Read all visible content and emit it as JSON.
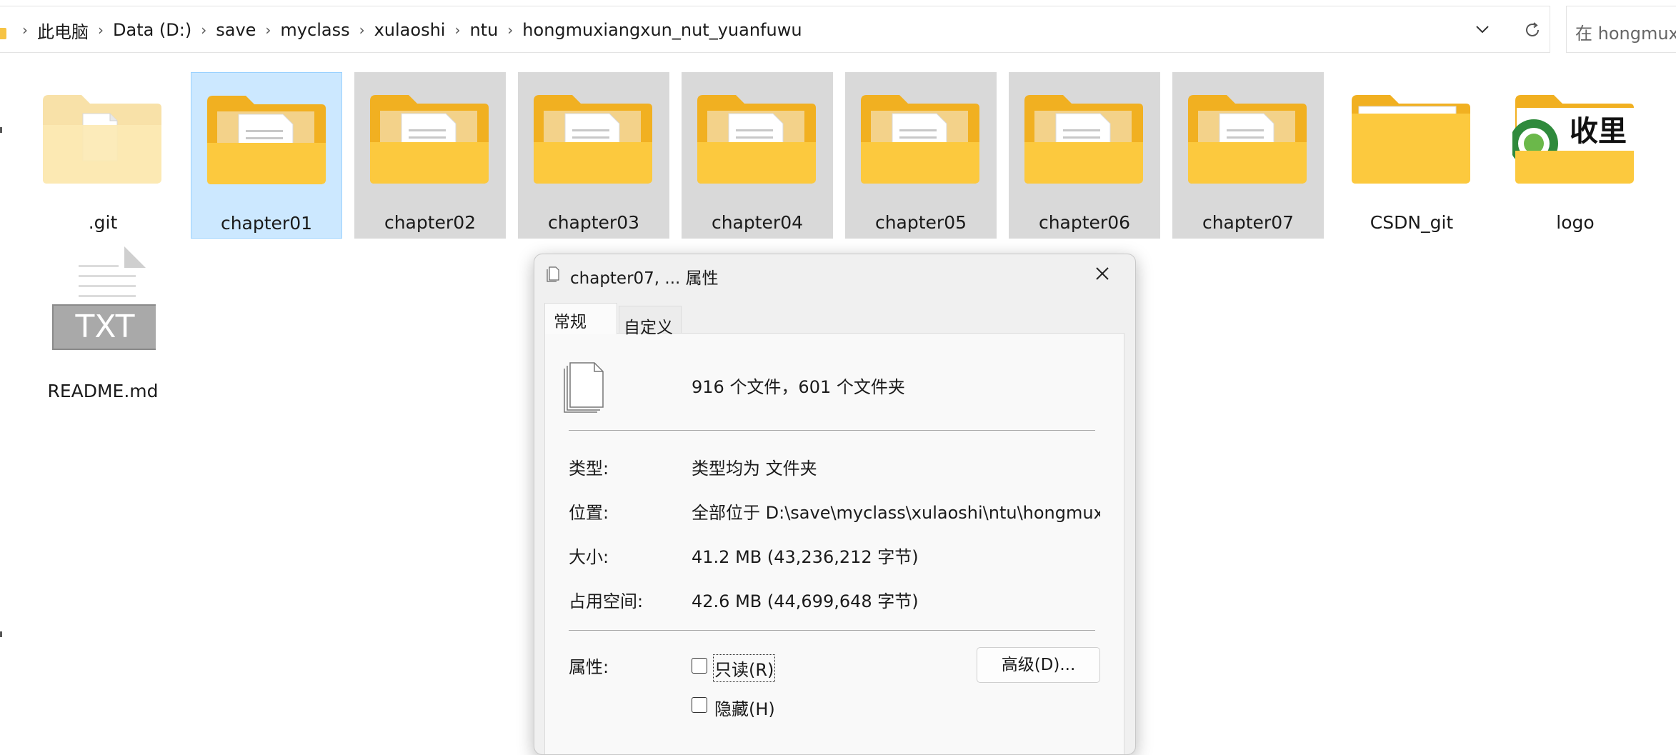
{
  "addressbar": {
    "breadcrumbs": [
      "此电脑",
      "Data (D:)",
      "save",
      "myclass",
      "xulaoshi",
      "ntu",
      "hongmuxiangxun_nut_yuanfuwu"
    ],
    "search_placeholder": "在 hongmux"
  },
  "files": [
    {
      "name": ".git",
      "kind": "folder-faded",
      "state": "normal"
    },
    {
      "name": "chapter01",
      "kind": "folder-docs",
      "state": "selected"
    },
    {
      "name": "chapter02",
      "kind": "folder-docs",
      "state": "highlighted"
    },
    {
      "name": "chapter03",
      "kind": "folder-docs",
      "state": "highlighted"
    },
    {
      "name": "chapter04",
      "kind": "folder-docs",
      "state": "highlighted"
    },
    {
      "name": "chapter05",
      "kind": "folder-docs",
      "state": "highlighted"
    },
    {
      "name": "chapter06",
      "kind": "folder-docs",
      "state": "highlighted"
    },
    {
      "name": "chapter07",
      "kind": "folder-docs",
      "state": "highlighted"
    },
    {
      "name": "CSDN_git",
      "kind": "folder-plain",
      "state": "normal"
    },
    {
      "name": "logo",
      "kind": "folder-logo",
      "state": "normal"
    },
    {
      "name": "README.md",
      "kind": "txt-file",
      "state": "normal"
    }
  ],
  "logo_thumbnail_text": "收里",
  "txt_icon_text": "TXT",
  "dialog": {
    "title": "chapter07, ... 属性",
    "tabs": [
      "常规",
      "自定义"
    ],
    "summary": "916 个文件，601 个文件夹",
    "rows": [
      {
        "label": "类型:",
        "value": "类型均为 文件夹"
      },
      {
        "label": "位置:",
        "value": "全部位于 D:\\save\\myclass\\xulaoshi\\ntu\\hongmuxiangxun_nut_yuanfuwu"
      },
      {
        "label": "大小:",
        "value": "41.2 MB (43,236,212 字节)"
      },
      {
        "label": "占用空间:",
        "value": "42.6 MB (44,699,648 字节)"
      }
    ],
    "attributes_label": "属性:",
    "readonly_label": "只读(R)",
    "hidden_label": "隐藏(H)",
    "advanced_button": "高级(D)..."
  },
  "colors": {
    "selected_bg": "#cce8ff",
    "highlight_bg": "#d9d9d9",
    "folder_yellow": "#f6c344"
  }
}
